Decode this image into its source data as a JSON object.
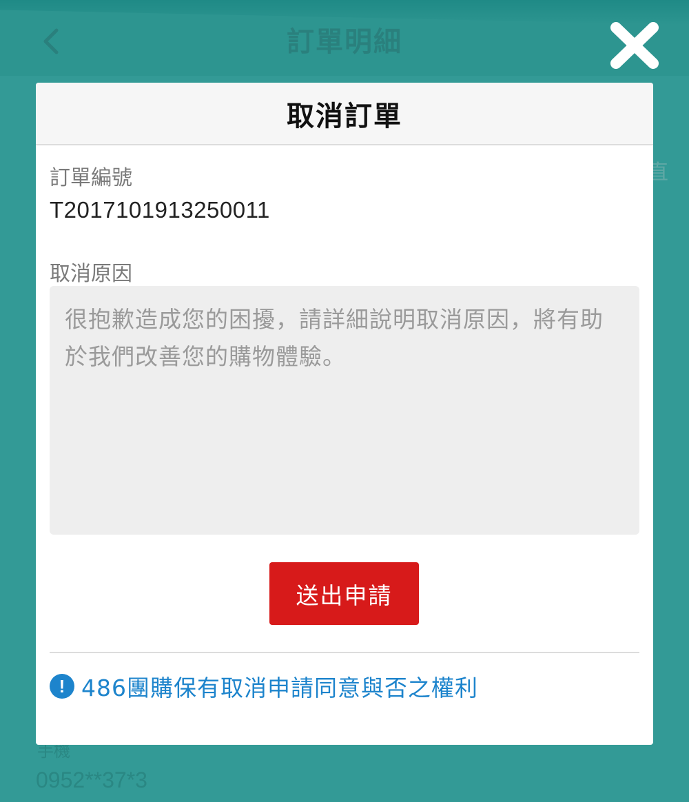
{
  "background": {
    "header_title": "訂單明細",
    "side_text": "直",
    "phone_label": "手機",
    "phone_value": "0952**37*3"
  },
  "modal": {
    "title": "取消訂單",
    "order_label": "訂單編號",
    "order_number": "T2017101913250011",
    "reason_label": "取消原因",
    "reason_placeholder": "很抱歉造成您的困擾，請詳細說明取消原因，將有助於我們改善您的購物體驗。",
    "reason_value": "",
    "submit_label": "送出申請",
    "notice_icon": "!",
    "notice_text": "486團購保有取消申請同意與否之權利"
  },
  "icons": {
    "back": "chevron-left-icon",
    "close": "close-icon",
    "notice": "exclamation-circle-icon"
  },
  "colors": {
    "overlay": "#339a96",
    "submit_button": "#d71a1a",
    "notice": "#1d84cc",
    "input_background": "#eeeeee"
  }
}
